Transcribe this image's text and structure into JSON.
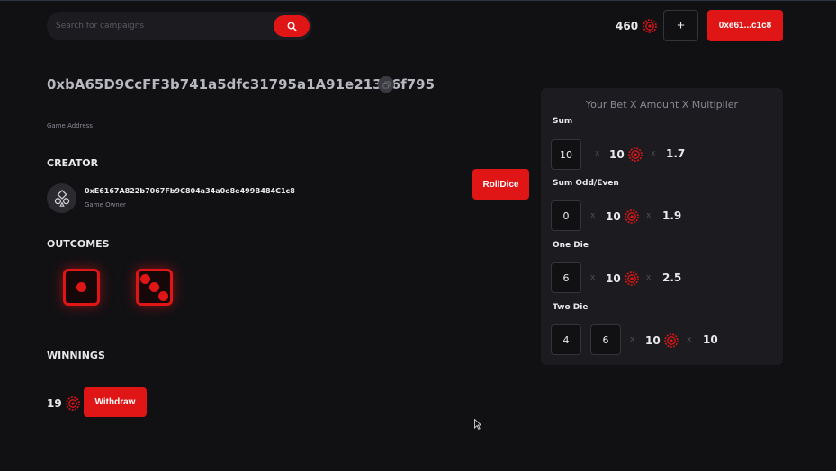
{
  "header": {
    "search_placeholder": "Search for campaigns",
    "balance": "460",
    "plus_label": "+",
    "wallet_label": "0xe61...c1c8"
  },
  "game": {
    "address": "0xbA65D9CcFF3b741a5dfc31795a1A91e213E6f795",
    "address_label": "Game Address"
  },
  "creator": {
    "heading": "CREATOR",
    "address": "0xE6167A822b7067Fb9C804a34a0e8e499B484C1c8",
    "role": "Game Owner"
  },
  "outcomes": {
    "heading": "OUTCOMES",
    "dice": [
      1,
      3
    ]
  },
  "winnings": {
    "heading": "WINNINGS",
    "amount": "19",
    "withdraw_label": "Withdraw"
  },
  "roll_label": "RollDice",
  "bet_panel": {
    "title": "Your Bet X Amount X Multiplier",
    "times_symbol": "x",
    "rows": [
      {
        "label": "Sum",
        "inputs": [
          "10"
        ],
        "amount": "10",
        "multiplier": "1.7"
      },
      {
        "label": "Sum Odd/Even",
        "inputs": [
          "0"
        ],
        "amount": "10",
        "multiplier": "1.9"
      },
      {
        "label": "One Die",
        "inputs": [
          "6"
        ],
        "amount": "10",
        "multiplier": "2.5"
      },
      {
        "label": "Two Die",
        "inputs": [
          "4",
          "6"
        ],
        "amount": "10",
        "multiplier": "10"
      }
    ]
  },
  "colors": {
    "accent": "#e01515",
    "background": "#111114",
    "panel": "#1c1c20"
  }
}
